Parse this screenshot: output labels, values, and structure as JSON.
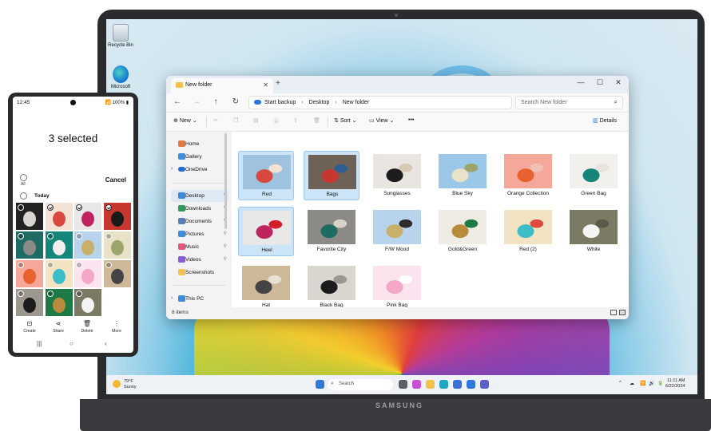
{
  "desktop": {
    "icons": [
      {
        "label": "Recycle Bin",
        "icon": "recycle-bin-icon"
      },
      {
        "label": "Microsoft",
        "icon": "edge-browser-icon"
      }
    ],
    "brand": "SAMSUNG"
  },
  "explorer": {
    "tab_title": "New folder",
    "new_tab": "+",
    "window_controls": {
      "minimize": "—",
      "maximize": "☐",
      "close": "✕"
    },
    "nav": {
      "back": "←",
      "forward": "→",
      "up": "↑",
      "refresh": "↻"
    },
    "address": {
      "backup": "Start backup",
      "crumbs": [
        "Desktop",
        "New folder"
      ],
      "sep": "›"
    },
    "search_placeholder": "Search New folder",
    "toolbar": {
      "new": "New",
      "sort": "Sort",
      "view": "View",
      "more": "•••",
      "details": "Details"
    },
    "sidebar": {
      "top": [
        {
          "label": "Home",
          "icon": "home-icon",
          "color": "#e27a3f"
        },
        {
          "label": "Gallery",
          "icon": "gallery-icon",
          "color": "#3d8ee0"
        },
        {
          "label": "OneDrive",
          "icon": "onedrive-icon",
          "color": "#1f6fd1"
        }
      ],
      "pinned": [
        {
          "label": "Desktop",
          "icon": "desktop-icon",
          "color": "#3b8bd9"
        },
        {
          "label": "Downloads",
          "icon": "downloads-icon",
          "color": "#2e9c58"
        },
        {
          "label": "Documents",
          "icon": "documents-icon",
          "color": "#5a7fb5"
        },
        {
          "label": "Pictures",
          "icon": "pictures-icon",
          "color": "#3d8ee0"
        },
        {
          "label": "Music",
          "icon": "music-icon",
          "color": "#e0577b"
        },
        {
          "label": "Videos",
          "icon": "videos-icon",
          "color": "#8b5cd6"
        },
        {
          "label": "Screenshots",
          "icon": "folder-icon",
          "color": "#f2c14e"
        }
      ],
      "this_pc": {
        "label": "This PC",
        "icon": "this-pc-icon",
        "color": "#3b8bd9"
      },
      "pin_glyph": "📌",
      "chevron": "›"
    },
    "files": [
      {
        "name": "Red",
        "selected": true,
        "colors": [
          "#9fc3df",
          "#d8483f",
          "#f3e3d6"
        ]
      },
      {
        "name": "Bags",
        "selected": true,
        "colors": [
          "#6e6257",
          "#c7362f",
          "#2e5e8f"
        ]
      },
      {
        "name": "Sunglasses",
        "selected": false,
        "colors": [
          "#e9e6e1",
          "#1d1d1d",
          "#d8c8b4"
        ]
      },
      {
        "name": "Blue Sky",
        "selected": false,
        "colors": [
          "#9bc7e8",
          "#e8e2c8",
          "#9ea56b"
        ]
      },
      {
        "name": "Orange Collection",
        "selected": false,
        "colors": [
          "#f5a899",
          "#e8612f",
          "#f0c2b4"
        ]
      },
      {
        "name": "Green Bag",
        "selected": false,
        "colors": [
          "#f2f0ec",
          "#14867a",
          "#e8e4dc"
        ]
      },
      {
        "name": "Heel",
        "selected": true,
        "colors": [
          "#e8e8e8",
          "#c0245e",
          "#d41d2a"
        ]
      },
      {
        "name": "Favorite City",
        "selected": false,
        "colors": [
          "#8c8a86",
          "#1e6b63",
          "#d9d2c6"
        ]
      },
      {
        "name": "F/W Mood",
        "selected": false,
        "colors": [
          "#b8d3ec",
          "#c8b06a",
          "#2d2d2d"
        ]
      },
      {
        "name": "Gold&Green",
        "selected": false,
        "colors": [
          "#efece6",
          "#b98b3d",
          "#1e7a45"
        ]
      },
      {
        "name": "Red (2)",
        "selected": false,
        "colors": [
          "#f2e3c2",
          "#3dbdc8",
          "#e04a3e"
        ]
      },
      {
        "name": "White",
        "selected": false,
        "colors": [
          "#7b7a64",
          "#f4f4f2",
          "#5a5a4a"
        ]
      },
      {
        "name": "Hat",
        "selected": false,
        "colors": [
          "#cdb89a",
          "#444444",
          "#e8e0d0"
        ]
      },
      {
        "name": "Black Bag",
        "selected": false,
        "colors": [
          "#d9d6d0",
          "#1c1c1c",
          "#9c9890"
        ]
      },
      {
        "name": "Pink Bag",
        "selected": false,
        "colors": [
          "#fbe4ee",
          "#f4a7c8",
          "#ffffff"
        ]
      }
    ],
    "status": "8 items"
  },
  "taskbar": {
    "weather_temp": "79°F",
    "weather_desc": "Sunny",
    "search_placeholder": "Search",
    "clock_time": "11:11 AM",
    "clock_date": "6/22/2024",
    "apps": [
      {
        "icon": "start-icon",
        "color": "#2f7ad8"
      },
      {
        "icon": "task-view-icon",
        "color": "#5b5f66"
      },
      {
        "icon": "copilot-icon",
        "color": "#c84fd1"
      },
      {
        "icon": "file-explorer-icon",
        "color": "#f2c14e"
      },
      {
        "icon": "edge-icon",
        "color": "#1fa7c4"
      },
      {
        "icon": "store-icon",
        "color": "#3c6fd8"
      },
      {
        "icon": "mail-icon",
        "color": "#2f7ad8"
      },
      {
        "icon": "teams-icon",
        "color": "#5b5fc7"
      }
    ],
    "tray": [
      "^",
      "☁",
      "🛜",
      "🔊",
      "🔋"
    ]
  },
  "phone": {
    "time": "12:45",
    "status": "📶 100% ▮",
    "title": "3 selected",
    "all_label": "All",
    "cancel": "Cancel",
    "today": "Today",
    "photos": [
      {
        "checked": false,
        "colors": [
          "#d9d5cf",
          "#222222"
        ]
      },
      {
        "checked": true,
        "colors": [
          "#d8483f",
          "#f3e3d6"
        ]
      },
      {
        "checked": true,
        "colors": [
          "#c0245e",
          "#e8e8e8"
        ]
      },
      {
        "checked": true,
        "colors": [
          "#1a1a1a",
          "#c7362f"
        ]
      },
      {
        "checked": false,
        "colors": [
          "#8c8a86",
          "#1e6b63"
        ]
      },
      {
        "checked": false,
        "colors": [
          "#f2f0ec",
          "#14867a"
        ]
      },
      {
        "checked": false,
        "colors": [
          "#c8b06a",
          "#b8d3ec"
        ]
      },
      {
        "checked": false,
        "colors": [
          "#9ea56b",
          "#e8e2c8"
        ]
      },
      {
        "checked": false,
        "colors": [
          "#e8612f",
          "#f5a899"
        ]
      },
      {
        "checked": false,
        "colors": [
          "#3dbdc8",
          "#f2e3c2"
        ]
      },
      {
        "checked": false,
        "colors": [
          "#f4a7c8",
          "#fbe4ee"
        ]
      },
      {
        "checked": false,
        "colors": [
          "#444444",
          "#cdb89a"
        ]
      },
      {
        "checked": false,
        "colors": [
          "#1c1c1c",
          "#9c9890"
        ]
      },
      {
        "checked": false,
        "colors": [
          "#b98b3d",
          "#1e7a45"
        ]
      },
      {
        "checked": false,
        "colors": [
          "#f4f4f2",
          "#7b7a64"
        ]
      }
    ],
    "actions": [
      {
        "label": "Create",
        "icon": "create-icon",
        "glyph": "⊡"
      },
      {
        "label": "Share",
        "icon": "share-icon",
        "glyph": "⋖"
      },
      {
        "label": "Delete",
        "icon": "delete-icon",
        "glyph": "🗑"
      },
      {
        "label": "More",
        "icon": "more-icon",
        "glyph": "⋮"
      }
    ],
    "nav": [
      "|||",
      "○",
      "‹"
    ]
  }
}
